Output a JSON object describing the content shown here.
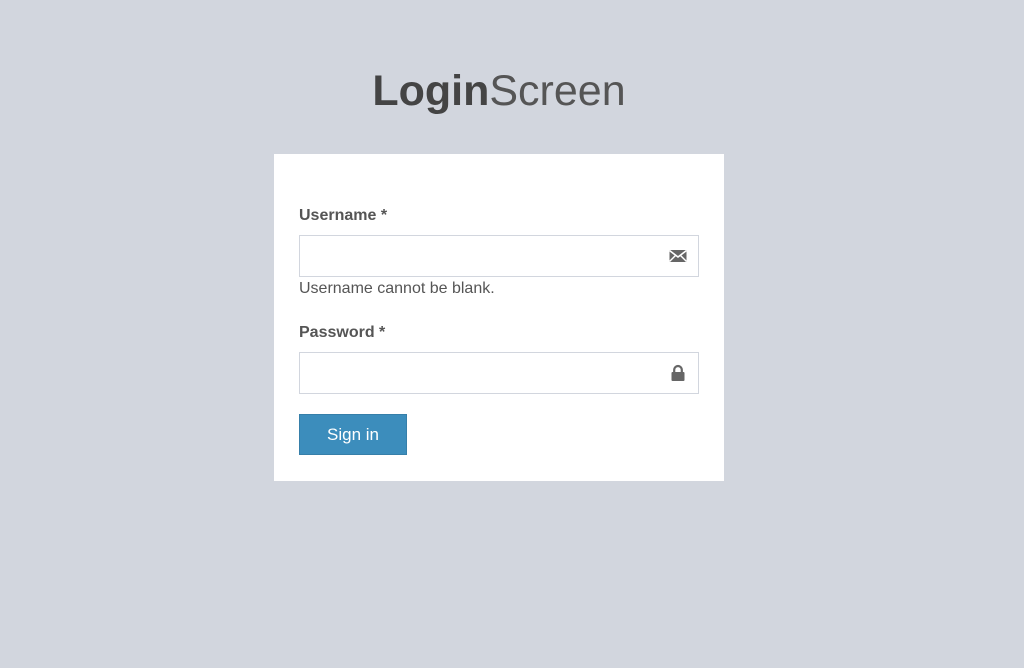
{
  "logo": {
    "bold": "Login",
    "light": "Screen"
  },
  "form": {
    "username": {
      "label": "Username *",
      "value": "",
      "placeholder": "",
      "icon": "envelope-icon",
      "error": "Username cannot be blank."
    },
    "password": {
      "label": "Password *",
      "value": "",
      "placeholder": "",
      "icon": "lock-icon"
    },
    "submit_label": "Sign in"
  },
  "colors": {
    "page_background": "#d2d6de",
    "box_background": "#ffffff",
    "primary_button": "#3c8dbc",
    "text": "#444444"
  }
}
